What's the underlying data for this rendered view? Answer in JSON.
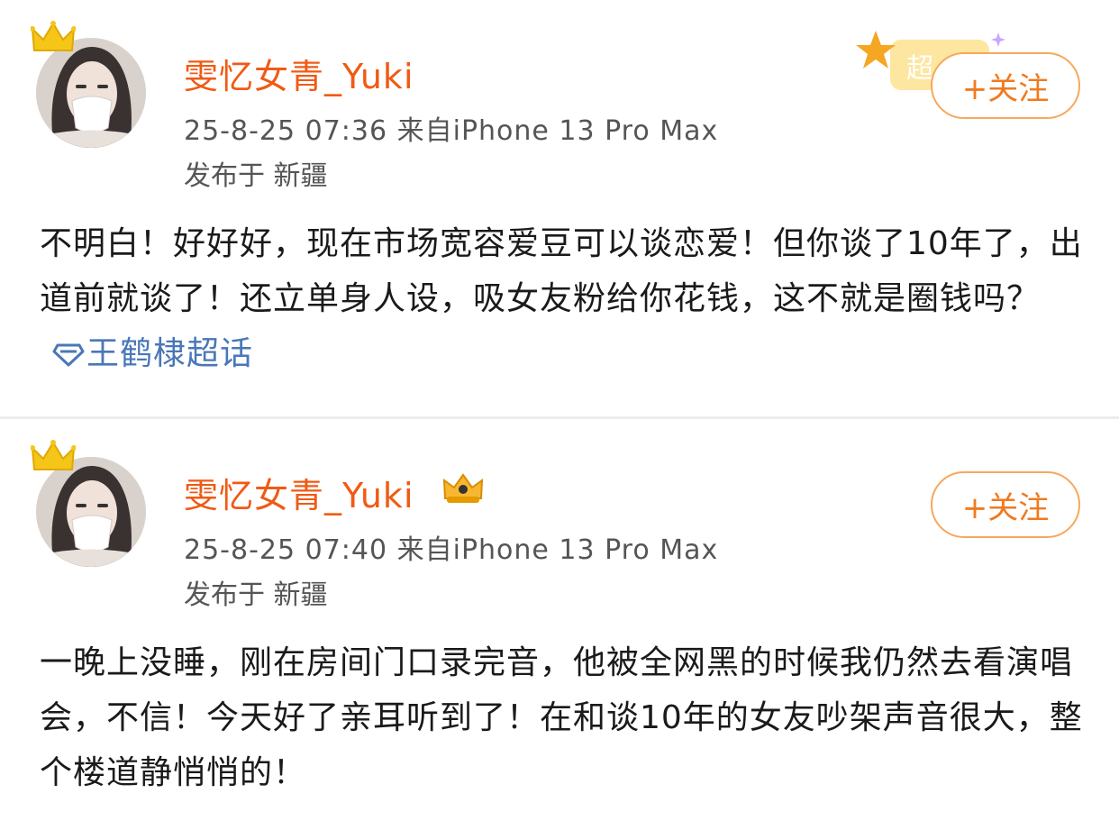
{
  "posts": [
    {
      "username": "雯忆女青_Yuki",
      "meta": "25-8-25 07:36  来自iPhone 13 Pro Max",
      "location": "发布于 新疆",
      "follow_label": "+关注",
      "body": "不明白！好好好，现在市场宽容爱豆可以谈恋爱！但你谈了10年了，出道前就谈了！还立单身人设，吸女友粉给你花钱，这不就是圈钱吗？",
      "topic": "王鹤棣超话",
      "badge_text": "超"
    },
    {
      "username": "雯忆女青_Yuki",
      "meta": "25-8-25 07:40  来自iPhone 13 Pro Max",
      "location": "发布于 新疆",
      "follow_label": "+关注",
      "body": "一晚上没睡，刚在房间门口录完音，他被全网黑的时候我仍然去看演唱会，不信！今天好了亲耳听到了！在和谈10年的女友吵架声音很大，整个楼道静悄悄的！"
    }
  ],
  "colors": {
    "username": "#f05a14",
    "follow_border": "#f7a85a",
    "follow_text": "#f07a1e",
    "topic_link": "#4a77b8",
    "crown": "#f5c518"
  },
  "icons": {
    "crown": "crown-icon",
    "vip": "vip-crown-icon",
    "topic": "super-topic-diamond-icon",
    "badge": "super-topic-star-badge-icon"
  }
}
